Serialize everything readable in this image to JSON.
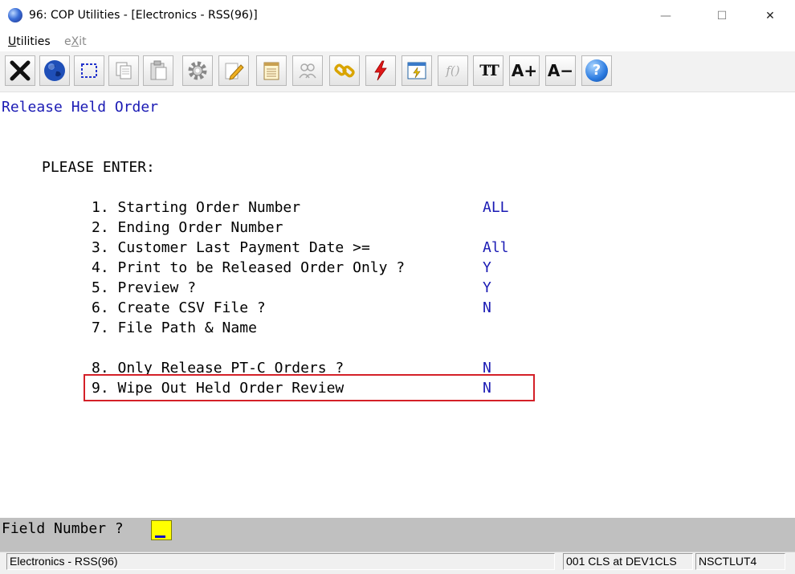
{
  "window": {
    "title": "96: COP Utilities - [Electronics - RSS(96)]",
    "controls": {
      "minimize": "—",
      "maximize": "☐",
      "close": "✕"
    }
  },
  "menu": [
    {
      "label": "Utilities",
      "mnemonic": "U"
    },
    {
      "label": "eXit",
      "mnemonic": "X"
    }
  ],
  "toolbar": {
    "buttons": [
      {
        "icon": "close-x-icon"
      },
      {
        "icon": "globe-icon"
      },
      {
        "icon": "select-box-icon"
      },
      {
        "icon": "copy-icon"
      },
      {
        "icon": "paste-icon"
      },
      {
        "icon": "settings-gear-icon"
      },
      {
        "icon": "edit-pencil-icon"
      },
      {
        "icon": "notepad-icon"
      },
      {
        "icon": "users-icon"
      },
      {
        "icon": "link-icon"
      },
      {
        "icon": "lightning-icon"
      },
      {
        "icon": "report-icon"
      },
      {
        "icon": "function-icon"
      },
      {
        "icon": "font-tt-icon"
      },
      {
        "icon": "font-increase-icon"
      },
      {
        "icon": "font-decrease-icon"
      },
      {
        "icon": "help-icon"
      }
    ],
    "font_tt_label": "TT",
    "font_increase_label": "A+",
    "font_decrease_label": "A−",
    "function_label": "f()",
    "help_label": "?"
  },
  "screen": {
    "heading": "Release Held Order",
    "prompt_intro": "PLEASE ENTER:",
    "fields": [
      {
        "label": "1. Starting Order Number",
        "value": "ALL"
      },
      {
        "label": "2. Ending Order Number",
        "value": ""
      },
      {
        "label": "3. Customer Last Payment Date >=",
        "value": "All"
      },
      {
        "label": "4. Print to be Released Order Only ?",
        "value": "Y"
      },
      {
        "label": "5. Preview ?",
        "value": "Y"
      },
      {
        "label": "6. Create CSV File ?",
        "value": "N"
      },
      {
        "label": "7. File Path & Name",
        "value": ""
      },
      {
        "label": "8. Only Release PT-C Orders ?",
        "value": "N"
      },
      {
        "label": "9. Wipe Out Held Order Review",
        "value": "N"
      }
    ],
    "field_prompt": "Field Number ?",
    "field_input_value": ""
  },
  "status_bar": {
    "company": "Electronics - RSS(96)",
    "session": "001 CLS at DEV1CLS",
    "program": "NSCTLUT4"
  },
  "colors": {
    "terminal_text": "#1a1ab4",
    "highlight_border": "#d42028",
    "input_background": "#ffff00",
    "prompt_bar": "#c0c0c0"
  }
}
